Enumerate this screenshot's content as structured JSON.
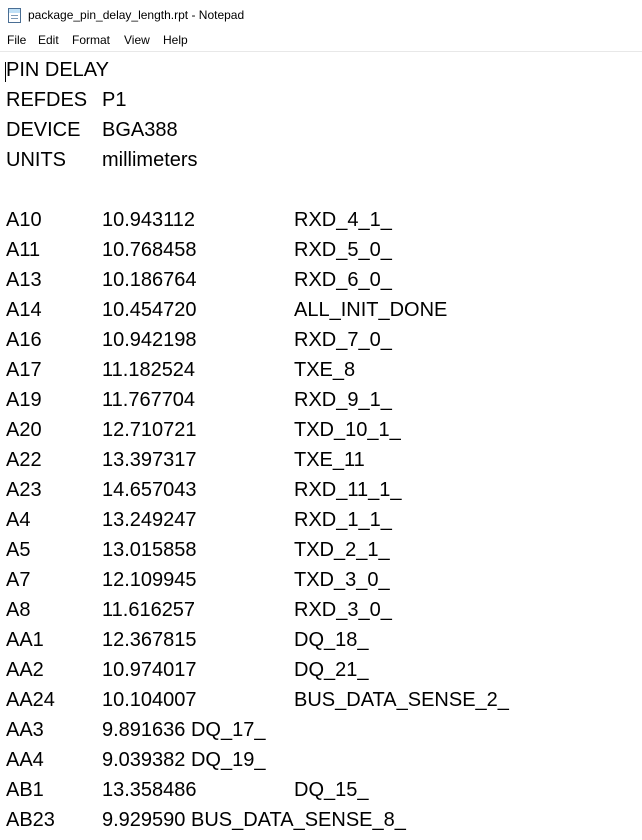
{
  "window": {
    "title": "package_pin_delay_length.rpt - Notepad"
  },
  "menu": {
    "items": [
      "File",
      "Edit",
      "Format",
      "View",
      "Help"
    ]
  },
  "document": {
    "header": [
      {
        "col1": "PIN DELAY",
        "col2": ""
      },
      {
        "col1": "REFDES",
        "col2": "P1"
      },
      {
        "col1": "DEVICE",
        "col2": "BGA388"
      },
      {
        "col1": "UNITS",
        "col2": "millimeters"
      }
    ],
    "rows": [
      {
        "pin": "A10",
        "delay": "10.943112",
        "net": "RXD_4_1_"
      },
      {
        "pin": "A11",
        "delay": "10.768458",
        "net": "RXD_5_0_"
      },
      {
        "pin": "A13",
        "delay": "10.186764",
        "net": "RXD_6_0_"
      },
      {
        "pin": "A14",
        "delay": "10.454720",
        "net": "ALL_INIT_DONE"
      },
      {
        "pin": "A16",
        "delay": "10.942198",
        "net": "RXD_7_0_"
      },
      {
        "pin": "A17",
        "delay": "11.182524",
        "net": "TXE_8"
      },
      {
        "pin": "A19",
        "delay": "11.767704",
        "net": "RXD_9_1_"
      },
      {
        "pin": "A20",
        "delay": "12.710721",
        "net": "TXD_10_1_"
      },
      {
        "pin": "A22",
        "delay": "13.397317",
        "net": "TXE_11"
      },
      {
        "pin": "A23",
        "delay": "14.657043",
        "net": "RXD_11_1_"
      },
      {
        "pin": "A4",
        "delay": "13.249247",
        "net": "RXD_1_1_"
      },
      {
        "pin": "A5",
        "delay": "13.015858",
        "net": "TXD_2_1_"
      },
      {
        "pin": "A7",
        "delay": "12.109945",
        "net": "TXD_3_0_"
      },
      {
        "pin": "A8",
        "delay": "11.616257",
        "net": "RXD_3_0_"
      },
      {
        "pin": "AA1",
        "delay": "12.367815",
        "net": "DQ_18_"
      },
      {
        "pin": "AA2",
        "delay": "10.974017",
        "net": "DQ_21_"
      },
      {
        "pin": "AA24",
        "delay": "10.104007",
        "net": "BUS_DATA_SENSE_2_"
      },
      {
        "pin": "AA3",
        "delay": "9.891636 DQ_17_",
        "net": ""
      },
      {
        "pin": "AA4",
        "delay": "9.039382 DQ_19_",
        "net": ""
      },
      {
        "pin": "AB1",
        "delay": "13.358486",
        "net": "DQ_15_"
      },
      {
        "pin": "AB23",
        "delay": "9.929590 BUS_DATA_SENSE_8_",
        "net": ""
      }
    ]
  }
}
